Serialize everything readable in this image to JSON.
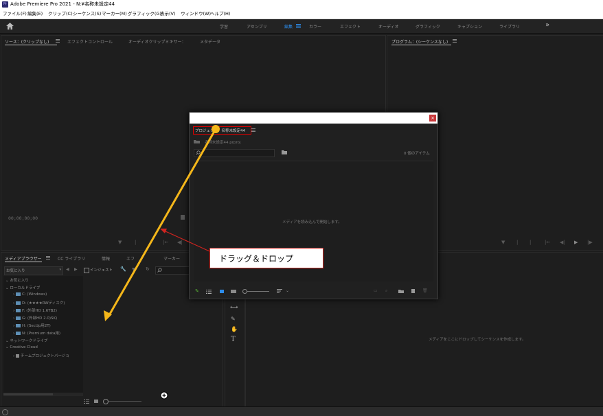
{
  "window": {
    "title": "Adobe Premiere Pro 2021 - N:¥名称未設定44",
    "icon": "Pr"
  },
  "menu": [
    "ファイル(F)",
    "編集(E)",
    "クリップ(C)",
    "シーケンス(S)",
    "マーカー(M)",
    "グラフィック(G)",
    "表示(V)",
    "ウィンドウ(W)",
    "ヘルプ(H)"
  ],
  "workspaces": {
    "items": [
      "学習",
      "アセンブリ",
      "編集",
      "カラー",
      "エフェクト",
      "オーディオ",
      "グラフィック",
      "キャプション",
      "ライブラリ"
    ],
    "active": "編集",
    "overflow_icon": "»"
  },
  "source_panel": {
    "tabs": [
      "ソース：(クリップなし)",
      "エフェクトコントロール",
      "オーディオクリップミキサー：",
      "メタデータ"
    ],
    "timecode": "00;00;00;00"
  },
  "program_panel": {
    "tab": "プログラム：(シーケンスなし)"
  },
  "media_browser": {
    "tabs": [
      "メディアブラウザー",
      "CC ライブラリ",
      "情報",
      "エフ",
      "マーカー"
    ],
    "favorites_select": "お気に入り",
    "ingest_label": "インジェスト",
    "tree": [
      {
        "label": "お気に入り",
        "level": 0
      },
      {
        "label": "ローカルドライブ",
        "level": 0
      },
      {
        "label": "C: (Windows)",
        "level": 1
      },
      {
        "label": "D: (★★★★RWディスク)",
        "level": 1
      },
      {
        "label": "F: (外部HD 1.6TB2)",
        "level": 1
      },
      {
        "label": "G: (外部HD 2.0)SK)",
        "level": 1
      },
      {
        "label": "H: (SecUp用2T)",
        "level": 1
      },
      {
        "label": "N: (Premium data用)",
        "level": 1
      },
      {
        "label": "ネットワークドライブ",
        "level": 0
      },
      {
        "label": "Creative Cloud",
        "level": 0
      },
      {
        "label": "チームプロジェクトバージョ",
        "level": 1
      }
    ]
  },
  "project_dialog": {
    "tab_label": "プロジェクト：名称未設定44",
    "file_name": "名称未設定44.prproj",
    "item_count": "0 個のアイテム",
    "empty_message": "メディアを読み込んで開始します。",
    "close_icon": "×"
  },
  "timeline_panel": {
    "empty_message": "メディアをここにドロップしてシーケンスを作成します。"
  },
  "annotation": {
    "callout_text": "ドラッグ＆ドロップ",
    "arrow_color": "#f5b71a",
    "callout_arrow_color": "#d0241f",
    "highlight_color": "#e00000"
  },
  "colors": {
    "accent": "#2d8ceb",
    "background": "#1d1d1d"
  }
}
